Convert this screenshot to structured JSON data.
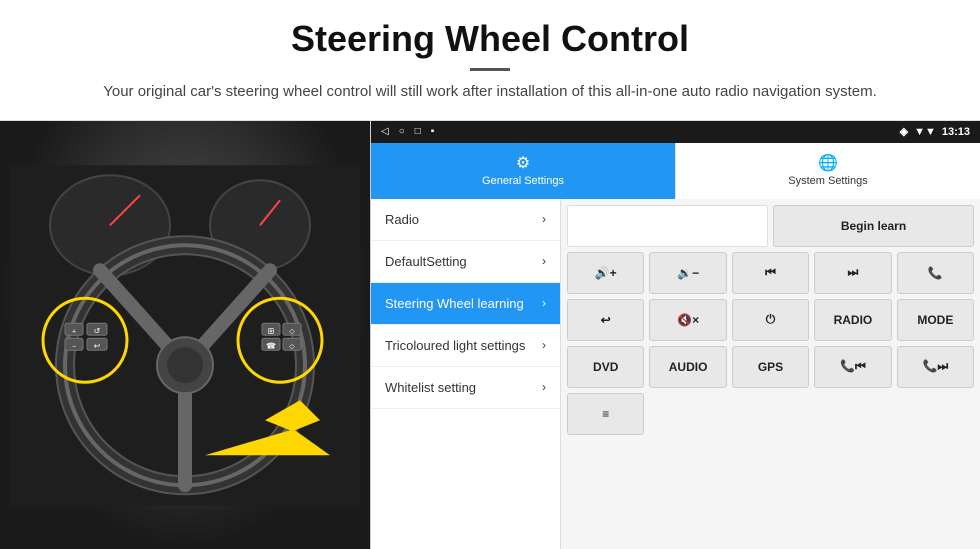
{
  "header": {
    "title": "Steering Wheel Control",
    "subtitle": "Your original car's steering wheel control will still work after installation of this all-in-one auto radio navigation system."
  },
  "status_bar": {
    "icons": [
      "◁",
      "○",
      "□",
      "▪"
    ],
    "signal_icon": "♦",
    "wifi_icon": "▼",
    "time": "13:13"
  },
  "tabs": [
    {
      "id": "general",
      "label": "General Settings",
      "icon": "⚙",
      "active": true
    },
    {
      "id": "system",
      "label": "System Settings",
      "icon": "🌐",
      "active": false
    }
  ],
  "menu_items": [
    {
      "id": "radio",
      "label": "Radio",
      "active": false
    },
    {
      "id": "default",
      "label": "DefaultSetting",
      "active": false
    },
    {
      "id": "steering",
      "label": "Steering Wheel learning",
      "active": true
    },
    {
      "id": "tricoloured",
      "label": "Tricoloured light settings",
      "active": false
    },
    {
      "id": "whitelist",
      "label": "Whitelist setting",
      "active": false
    }
  ],
  "controls": {
    "row1": [
      {
        "id": "empty1",
        "label": "",
        "type": "empty"
      },
      {
        "id": "begin-learn",
        "label": "Begin learn",
        "type": "normal"
      }
    ],
    "row2": [
      {
        "id": "vol-up",
        "label": "🔊+",
        "type": "normal"
      },
      {
        "id": "vol-down",
        "label": "🔉−",
        "type": "normal"
      },
      {
        "id": "prev",
        "label": "⏮",
        "type": "normal"
      },
      {
        "id": "next",
        "label": "⏭",
        "type": "normal"
      },
      {
        "id": "phone",
        "label": "📞",
        "type": "normal"
      }
    ],
    "row3": [
      {
        "id": "hangup",
        "label": "↩",
        "type": "normal"
      },
      {
        "id": "mute",
        "label": "🔇×",
        "type": "normal"
      },
      {
        "id": "power",
        "label": "⏻",
        "type": "normal"
      },
      {
        "id": "radio-btn",
        "label": "RADIO",
        "type": "normal"
      },
      {
        "id": "mode",
        "label": "MODE",
        "type": "normal"
      }
    ],
    "row4": [
      {
        "id": "dvd",
        "label": "DVD",
        "type": "normal"
      },
      {
        "id": "audio",
        "label": "AUDIO",
        "type": "normal"
      },
      {
        "id": "gps",
        "label": "GPS",
        "type": "normal"
      },
      {
        "id": "phone2",
        "label": "📞⏮",
        "type": "normal"
      },
      {
        "id": "phone3",
        "label": "📞⏭",
        "type": "normal"
      }
    ],
    "row5": [
      {
        "id": "list",
        "label": "≡",
        "type": "normal"
      }
    ]
  }
}
